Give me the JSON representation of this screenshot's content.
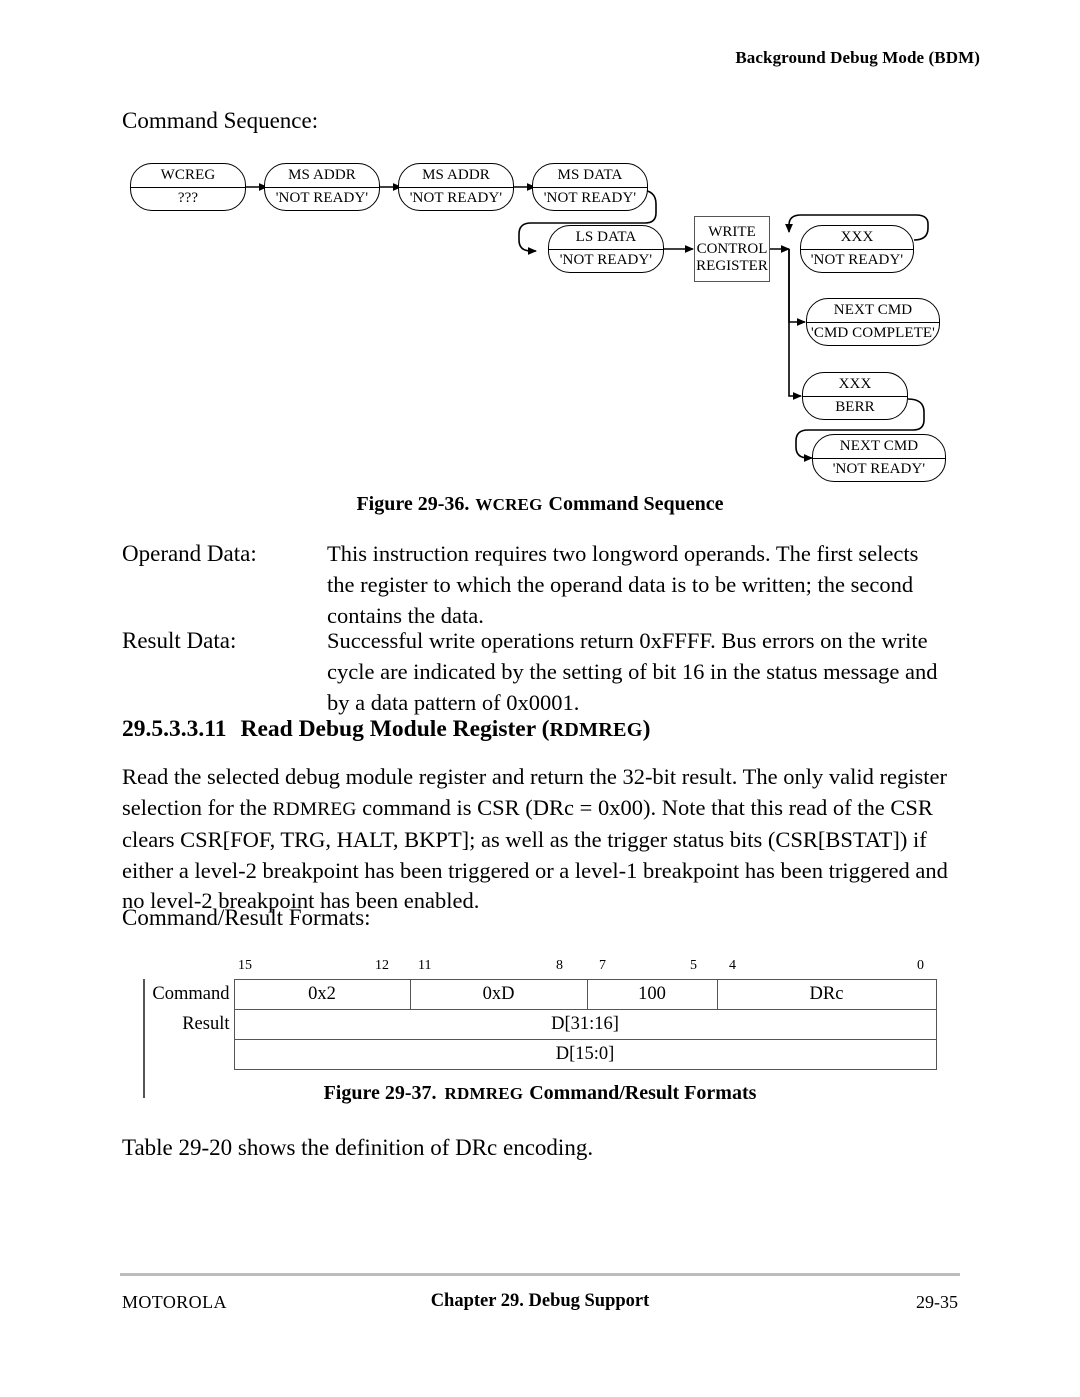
{
  "header": {
    "running_head": "Background Debug Mode (BDM)"
  },
  "command_sequence": {
    "label": "Command Sequence:"
  },
  "figure_29_36": {
    "caption_prefix": "Figure 29-36.",
    "caption_smallcaps": "WCREG",
    "caption_suffix": "Command Sequence",
    "nodes": [
      {
        "id": "wcreg",
        "top": "WCREG",
        "bottom": "???"
      },
      {
        "id": "ms-addr-1",
        "top": "MS ADDR",
        "bottom": "'NOT READY'"
      },
      {
        "id": "ms-addr-2",
        "top": "MS ADDR",
        "bottom": "'NOT READY'"
      },
      {
        "id": "ms-data",
        "top": "MS DATA",
        "bottom": "'NOT READY'"
      },
      {
        "id": "ls-data",
        "top": "LS DATA",
        "bottom": "'NOT READY'"
      },
      {
        "id": "xxx-not-ready",
        "top": "XXX",
        "bottom": "'NOT READY'"
      },
      {
        "id": "next-cmd-complete",
        "top": "NEXT CMD",
        "bottom": "'CMD COMPLETE'"
      },
      {
        "id": "xxx-berr",
        "top": "XXX",
        "bottom": "BERR"
      },
      {
        "id": "next-cmd-not-ready",
        "top": "NEXT CMD",
        "bottom": "'NOT READY'"
      }
    ],
    "process_box": {
      "line1": "WRITE",
      "line2": "CONTROL",
      "line3": "REGISTER"
    }
  },
  "operand_data": {
    "label": "Operand Data:",
    "line1": "This instruction requires two longword operands. The first selects",
    "line2": "the register to which the operand data is to be written; the second",
    "line3": "contains the data."
  },
  "result_data": {
    "label": "Result Data:",
    "line1": "Successful write operations return 0xFFFF. Bus errors on the write",
    "line2": "cycle are indicated by the setting of bit 16 in the status message and",
    "line3": "by a data pattern of 0x0001."
  },
  "section": {
    "number": "29.5.3.3.11",
    "title": "Read Debug Module Register (",
    "title_smallcaps": "RDMREG",
    "title_close": ")"
  },
  "section_body": {
    "line1": "Read the selected debug module register and return the 32-bit result. The only valid register",
    "line2_a": "selection for the ",
    "line2_sc": "RDMREG",
    "line2_b": " command is CSR (DRc = 0x00). Note that this read of the CSR",
    "line3": "clears CSR[FOF, TRG, HALT, BKPT]; as well as the trigger status bits (CSR[BSTAT]) if",
    "line4": "either a level-2 breakpoint has been triggered or a level-1 breakpoint has been triggered and",
    "line5": "no level-2 breakpoint has been enabled."
  },
  "formats": {
    "label": "Command/Result Formats:"
  },
  "bitfield": {
    "bit_ticks": [
      "15",
      "12",
      "11",
      "8",
      "7",
      "5",
      "4",
      "0"
    ],
    "row_labels": [
      "Command",
      "Result"
    ],
    "command_cells": [
      "0x2",
      "0xD",
      "100",
      "DRc"
    ],
    "result_cells": [
      "D[31:16]",
      "D[15:0]"
    ]
  },
  "figure_29_37": {
    "caption_prefix": "Figure 29-37.",
    "caption_smallcaps": "RDMREG",
    "caption_suffix": "Command/Result Formats"
  },
  "table_note": {
    "text": "Table 29-20 shows the definition of DRc encoding."
  },
  "footer": {
    "left": "MOTOROLA",
    "center": "Chapter 29. Debug Support",
    "right": "29-35"
  }
}
